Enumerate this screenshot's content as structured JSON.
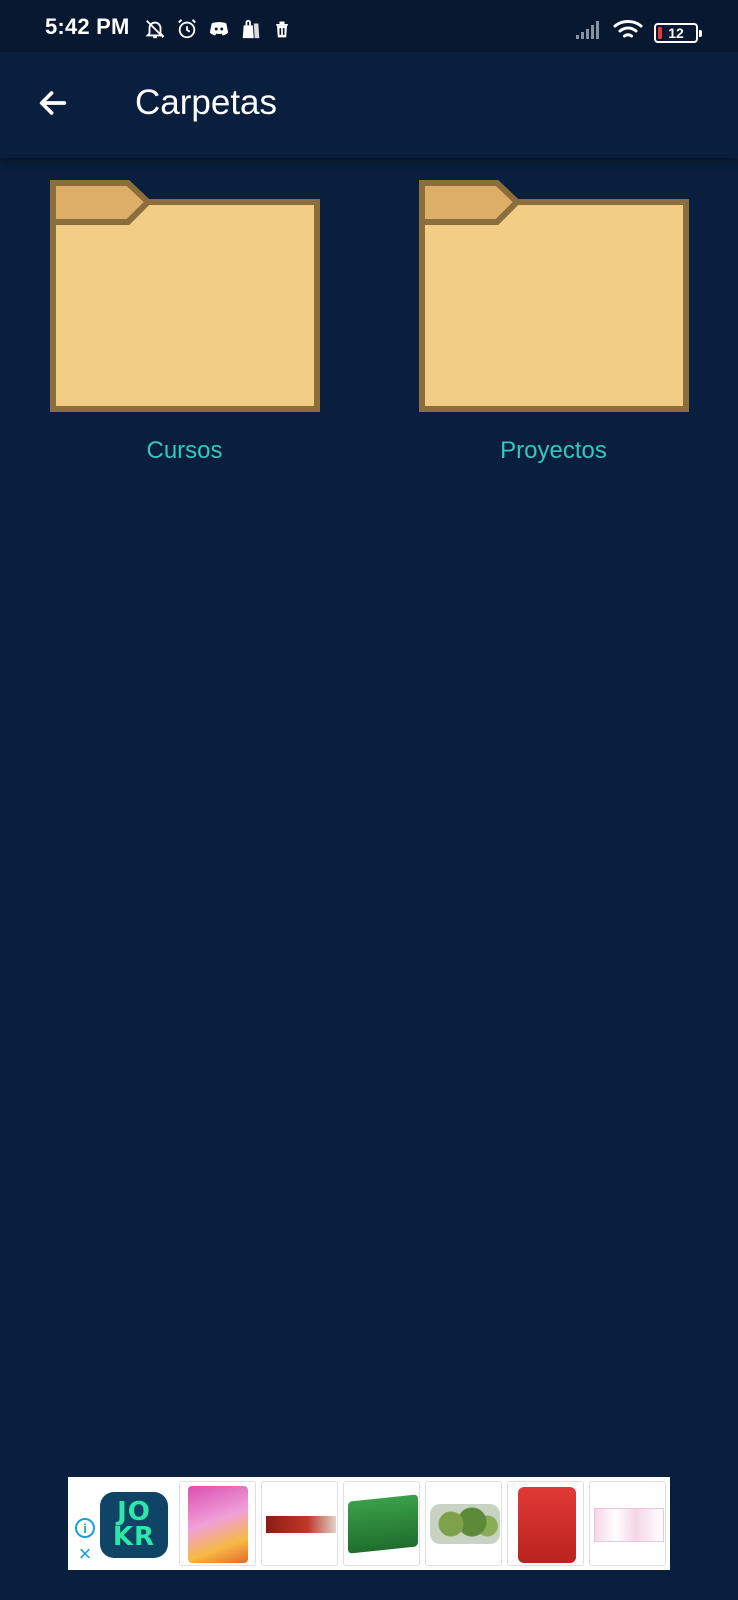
{
  "status_bar": {
    "time": "5:42 PM",
    "battery_level": "12",
    "icons_left": [
      "notifications-off-icon",
      "alarm-icon",
      "discord-icon",
      "shopping-bag-icon",
      "trash-icon"
    ],
    "icons_right": [
      "signal-icon",
      "wifi-icon",
      "battery-icon"
    ]
  },
  "app_bar": {
    "title": "Carpetas",
    "back_icon": "arrow-left-icon"
  },
  "folders": [
    {
      "label": "Cursos",
      "icon": "folder-icon"
    },
    {
      "label": "Proyectos",
      "icon": "folder-icon"
    }
  ],
  "ad_banner": {
    "logo_line1": "JO",
    "logo_line2": "KR",
    "info_icon": "i",
    "close_icon": "×",
    "products": [
      "product-gomitas",
      "product-fondo",
      "product-pilsen",
      "product-broccoli",
      "product-field",
      "product-tissue"
    ]
  },
  "colors": {
    "background": "#0a1e3d",
    "status_bar": "#071830",
    "folder_label": "#36c6bf",
    "folder_fill": "#f2cd86",
    "folder_tab": "#dcae68",
    "folder_border": "#8c6d3c"
  }
}
